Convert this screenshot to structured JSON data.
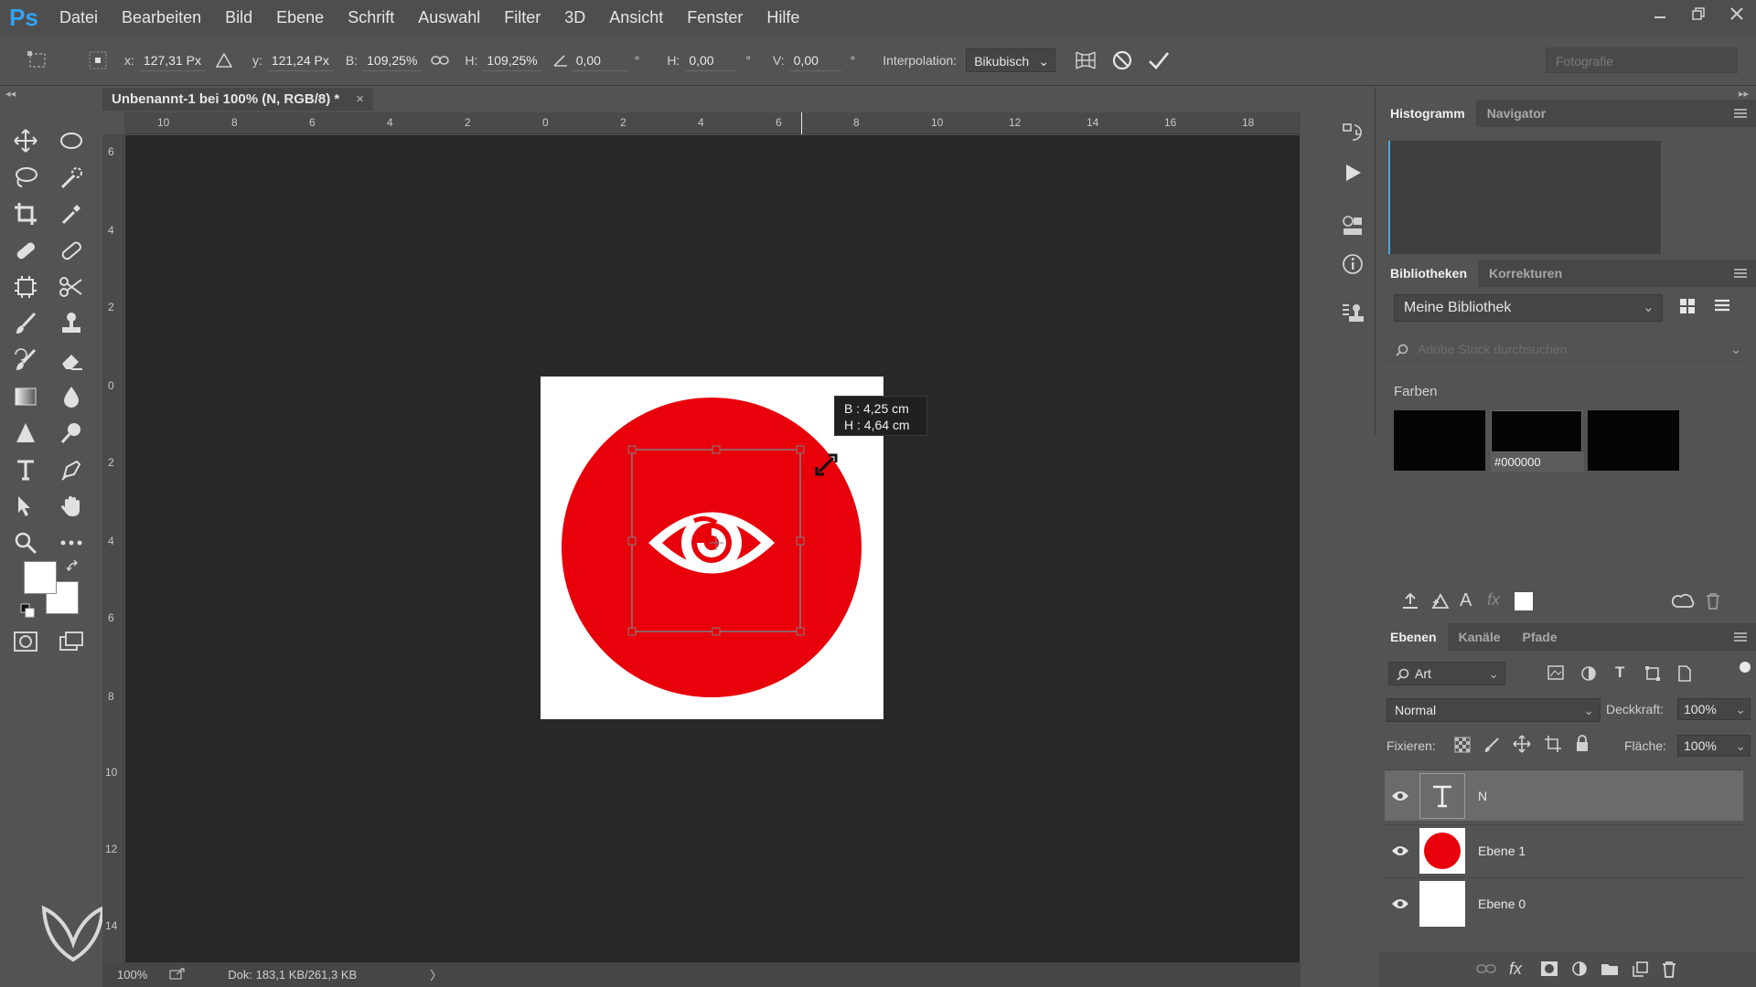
{
  "app": {
    "logo": "Ps"
  },
  "menu": [
    "Datei",
    "Bearbeiten",
    "Bild",
    "Ebene",
    "Schrift",
    "Auswahl",
    "Filter",
    "3D",
    "Ansicht",
    "Fenster",
    "Hilfe"
  ],
  "options": {
    "x_label": "x:",
    "x_value": "127,31 Px",
    "y_label": "y:",
    "y_value": "121,24 Px",
    "w_label": "B:",
    "w_value": "109,25%",
    "h_label": "H:",
    "h_value": "109,25%",
    "angle_value": "0,00",
    "deg": "°",
    "hskew_label": "H:",
    "hskew_value": "0,00",
    "vskew_label": "V:",
    "vskew_value": "0,00",
    "interp_label": "Interpolation:",
    "interp_value": "Bikubisch",
    "workspace": "Fotografie"
  },
  "document": {
    "tab_title": "Unbenannt-1 bei 100% (N, RGB/8) *",
    "tab_close": "×",
    "accent_red": "#e8000a"
  },
  "ruler": {
    "top_labels": [
      "10",
      "8",
      "6",
      "4",
      "2",
      "0",
      "2",
      "4",
      "6",
      "8",
      "10",
      "12",
      "14",
      "16",
      "18"
    ],
    "left_labels": [
      "6",
      "4",
      "2",
      "0",
      "2",
      "4",
      "6",
      "8",
      "10",
      "12",
      "14"
    ]
  },
  "tooltip": {
    "line1": "B :  4,25 cm",
    "line2": "H :  4,64 cm"
  },
  "status": {
    "zoom": "100%",
    "doc": "Dok: 183,1 KB/261,3 KB",
    "arrow": "〉"
  },
  "panels": {
    "top_tabs": [
      "Histogramm",
      "Navigator"
    ],
    "lib_tabs": [
      "Bibliotheken",
      "Korrekturen"
    ],
    "library": "Meine Bibliothek",
    "search_placeholder": "Adobe Stock durchsuchen",
    "farben": "Farben",
    "hex": "#000000",
    "layer_tabs": [
      "Ebenen",
      "Kanäle",
      "Pfade"
    ],
    "filter": "Art",
    "blend": "Normal",
    "opacity_label": "Deckkraft:",
    "opacity_value": "100%",
    "lock_label": "Fixieren:",
    "fill_label": "Fläche:",
    "fill_value": "100%",
    "layers": [
      {
        "name": "N",
        "thumb": "text"
      },
      {
        "name": "Ebene 1",
        "thumb": "red-circle"
      },
      {
        "name": "Ebene 0",
        "thumb": "white"
      }
    ]
  }
}
